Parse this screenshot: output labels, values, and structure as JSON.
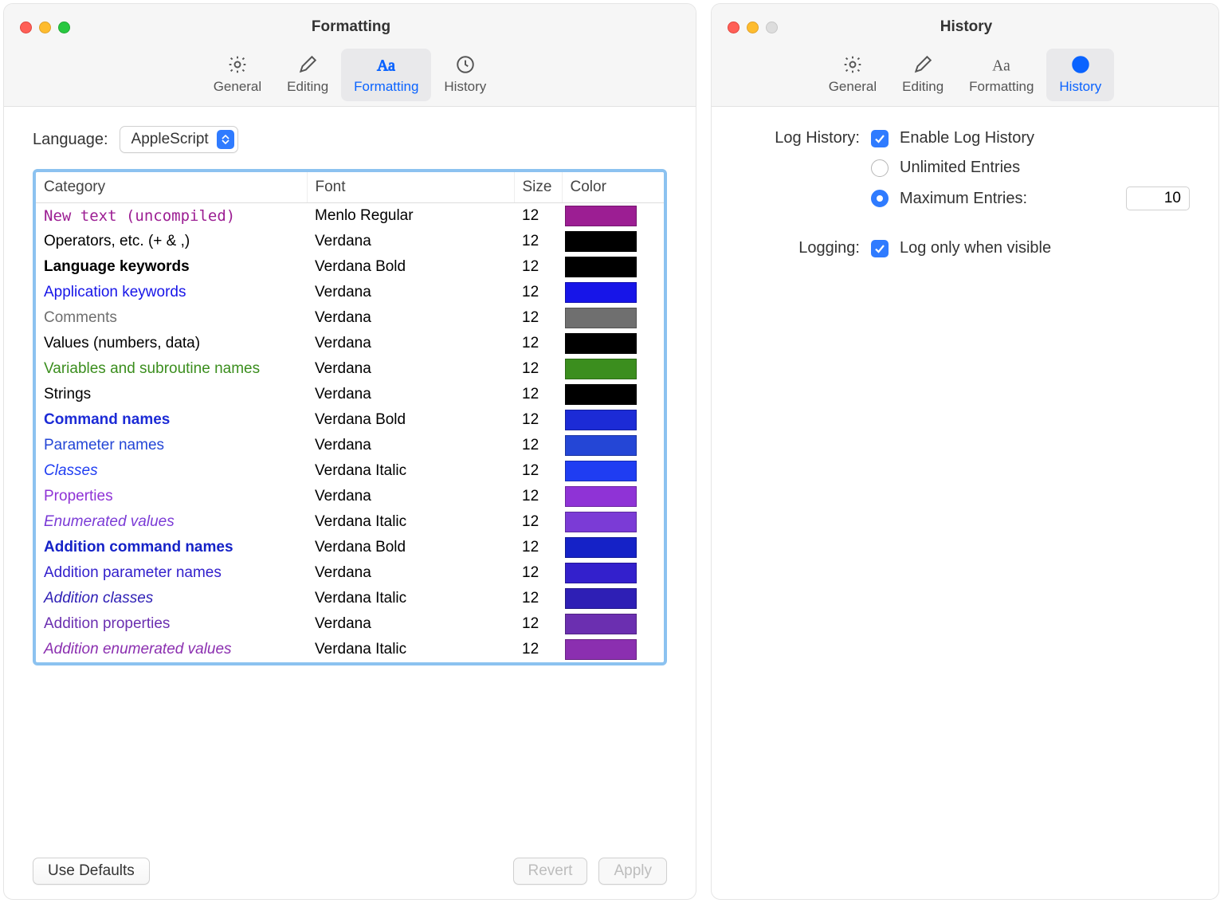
{
  "formatting_window": {
    "title": "Formatting",
    "tabs": {
      "general": "General",
      "editing": "Editing",
      "formatting": "Formatting",
      "history": "History"
    },
    "language_label": "Language:",
    "language_value": "AppleScript",
    "columns": {
      "category": "Category",
      "font": "Font",
      "size": "Size",
      "color": "Color"
    },
    "rows": [
      {
        "category": "New text (uncompiled)",
        "font": "Menlo Regular",
        "size": "12",
        "color": "#9c1e93",
        "style": "font-family:Menlo, monospace;color:#9c1e93;"
      },
      {
        "category": "Operators, etc. (+ & ,)",
        "font": "Verdana",
        "size": "12",
        "color": "#000000",
        "style": "color:#000;"
      },
      {
        "category": "Language keywords",
        "font": "Verdana Bold",
        "size": "12",
        "color": "#000000",
        "style": "font-weight:700;color:#000;"
      },
      {
        "category": "Application keywords",
        "font": "Verdana",
        "size": "12",
        "color": "#1715e8",
        "style": "color:#1715e8;"
      },
      {
        "category": "Comments",
        "font": "Verdana",
        "size": "12",
        "color": "#6f6f6f",
        "style": "color:#6f6f6f;"
      },
      {
        "category": "Values (numbers, data)",
        "font": "Verdana",
        "size": "12",
        "color": "#000000",
        "style": "color:#000;"
      },
      {
        "category": "Variables and subroutine names",
        "font": "Verdana",
        "size": "12",
        "color": "#3b8e1e",
        "style": "color:#3b8e1e;"
      },
      {
        "category": "Strings",
        "font": "Verdana",
        "size": "12",
        "color": "#000000",
        "style": "color:#000;"
      },
      {
        "category": "Command names",
        "font": "Verdana Bold",
        "size": "12",
        "color": "#1c2bd6",
        "style": "font-weight:700;color:#1c2bd6;"
      },
      {
        "category": "Parameter names",
        "font": "Verdana",
        "size": "12",
        "color": "#2446d6",
        "style": "color:#2446d6;"
      },
      {
        "category": "Classes",
        "font": "Verdana Italic",
        "size": "12",
        "color": "#1f3df2",
        "style": "font-style:italic;color:#1f3df2;"
      },
      {
        "category": "Properties",
        "font": "Verdana",
        "size": "12",
        "color": "#8f33d6",
        "style": "color:#8f33d6;"
      },
      {
        "category": "Enumerated values",
        "font": "Verdana Italic",
        "size": "12",
        "color": "#7b3bd6",
        "style": "font-style:italic;color:#7b3bd6;"
      },
      {
        "category": "Addition command names",
        "font": "Verdana Bold",
        "size": "12",
        "color": "#1522c7",
        "style": "font-weight:700;color:#1522c7;"
      },
      {
        "category": "Addition parameter names",
        "font": "Verdana",
        "size": "12",
        "color": "#3320cc",
        "style": "color:#3320cc;"
      },
      {
        "category": "Addition classes",
        "font": "Verdana Italic",
        "size": "12",
        "color": "#2e1fb5",
        "style": "font-style:italic;color:#2e1fb5;"
      },
      {
        "category": "Addition properties",
        "font": "Verdana",
        "size": "12",
        "color": "#6b2fb0",
        "style": "color:#6b2fb0;"
      },
      {
        "category": "Addition enumerated values",
        "font": "Verdana Italic",
        "size": "12",
        "color": "#8b2fb0",
        "style": "font-style:italic;color:#8b2fb0;"
      }
    ],
    "buttons": {
      "use_defaults": "Use Defaults",
      "revert": "Revert",
      "apply": "Apply"
    }
  },
  "history_window": {
    "title": "History",
    "tabs": {
      "general": "General",
      "editing": "Editing",
      "formatting": "Formatting",
      "history": "History"
    },
    "log_history_label": "Log History:",
    "enable_log": "Enable Log History",
    "unlimited": "Unlimited Entries",
    "maximum": "Maximum Entries:",
    "max_value": "10",
    "logging_label": "Logging:",
    "log_visible": "Log only when visible"
  }
}
